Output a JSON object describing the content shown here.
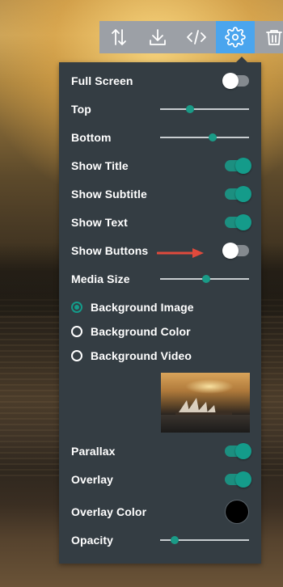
{
  "toolbar": {
    "buttons": [
      {
        "icon": "sort-arrows-icon"
      },
      {
        "icon": "download-icon"
      },
      {
        "icon": "code-icon"
      },
      {
        "icon": "gear-icon",
        "active": true
      },
      {
        "icon": "trash-icon"
      }
    ],
    "active_color": "#4aa5ee"
  },
  "panel": {
    "full_screen": {
      "label": "Full Screen",
      "on": false
    },
    "top": {
      "label": "Top",
      "value": 0.34
    },
    "bottom": {
      "label": "Bottom",
      "value": 0.59
    },
    "show_title": {
      "label": "Show Title",
      "on": true
    },
    "show_subtitle": {
      "label": "Show Subtitle",
      "on": true
    },
    "show_text": {
      "label": "Show Text",
      "on": true
    },
    "show_buttons": {
      "label": "Show Buttons",
      "on": false
    },
    "media_size": {
      "label": "Media Size",
      "value": 0.52
    },
    "background": {
      "options": [
        "Background Image",
        "Background Color",
        "Background Video"
      ],
      "selected": "Background Image"
    },
    "parallax": {
      "label": "Parallax",
      "on": true
    },
    "overlay": {
      "label": "Overlay",
      "on": true
    },
    "overlay_color": {
      "label": "Overlay Color",
      "color": "#000000"
    },
    "opacity": {
      "label": "Opacity",
      "value": 0.16
    }
  },
  "colors": {
    "panel_bg": "#343d43",
    "accent_teal": "#149b8a",
    "annotation_arrow": "#e04a3c"
  }
}
